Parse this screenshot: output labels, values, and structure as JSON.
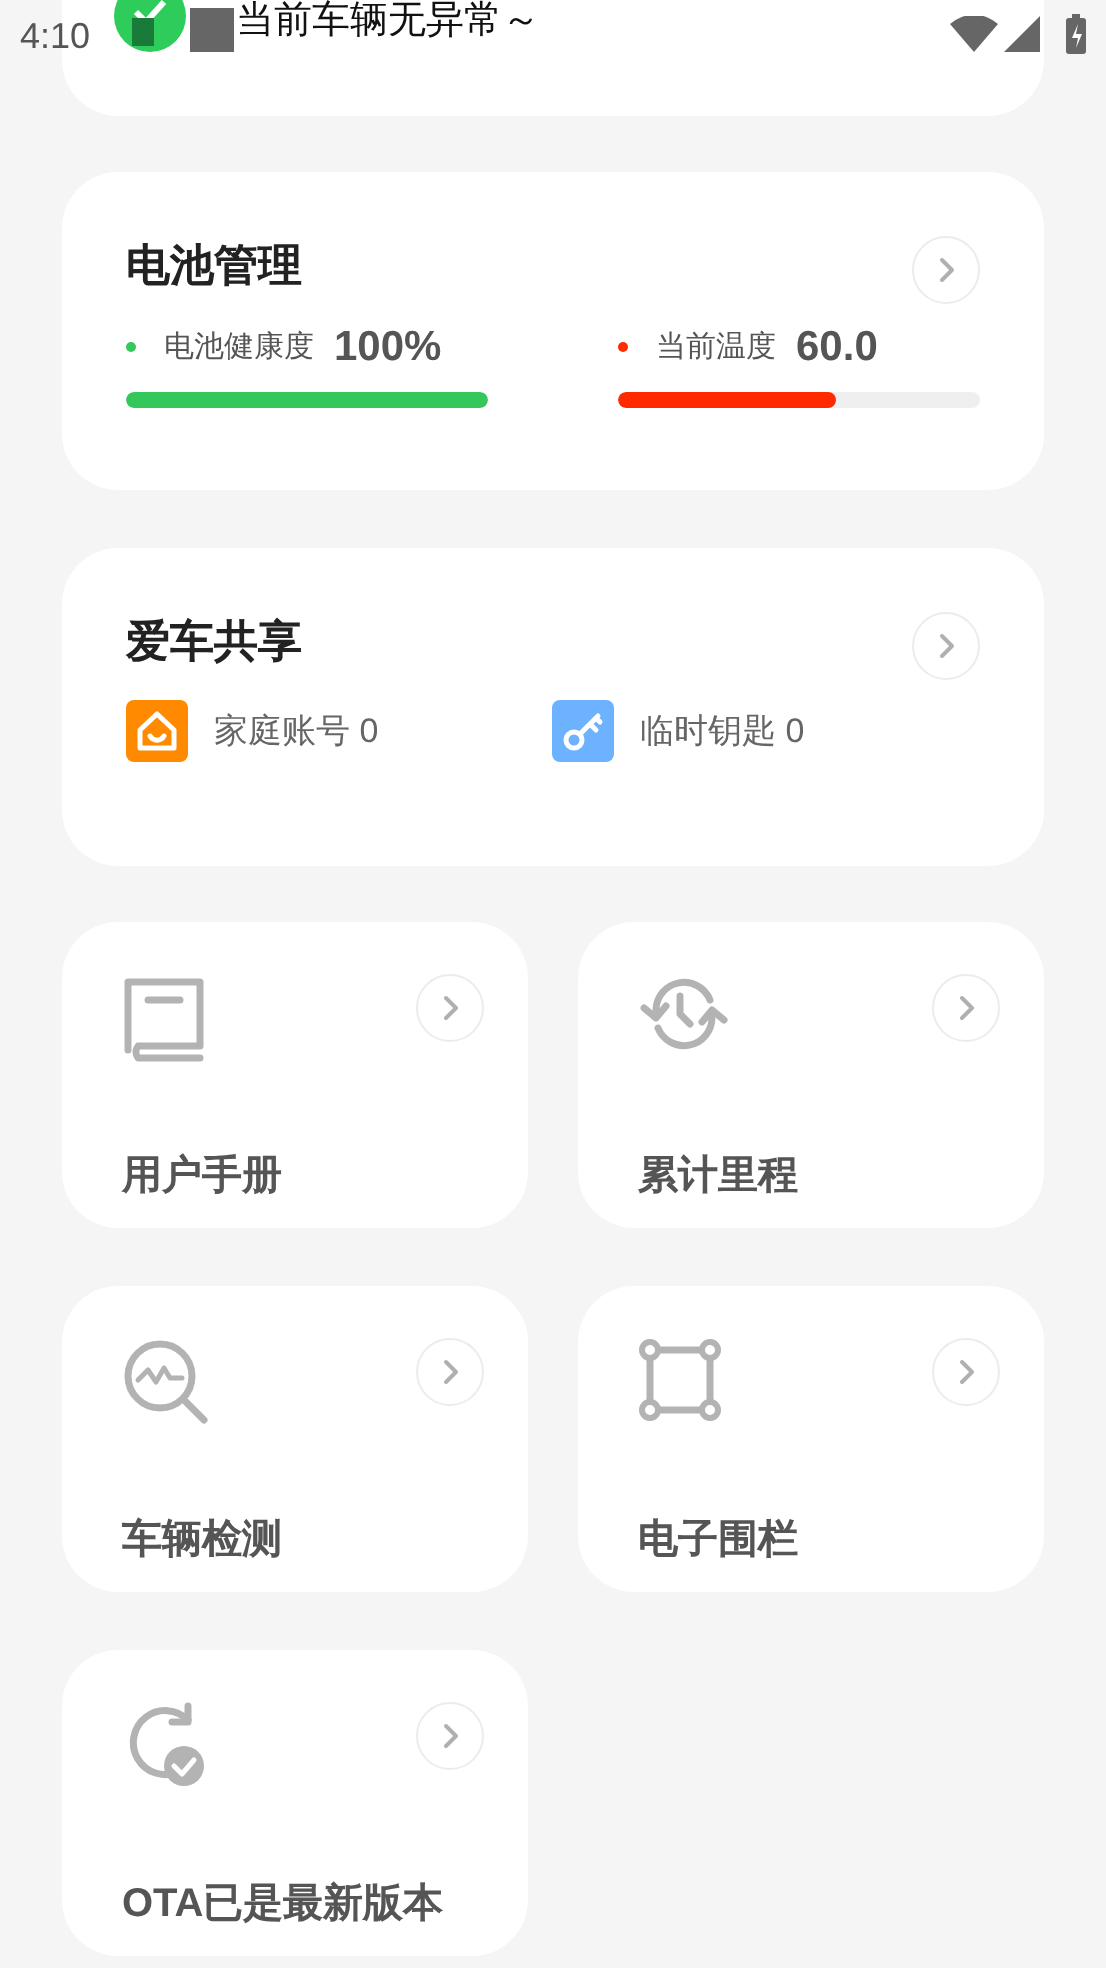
{
  "status_bar": {
    "time": "4:10"
  },
  "notice": {
    "text": "当前车辆无异常～"
  },
  "battery": {
    "title": "电池管理",
    "metrics": [
      {
        "label": "电池健康度",
        "value": "100%",
        "color": "#34c759",
        "level": 1
      },
      {
        "label": "当前温度",
        "value": "60.0",
        "color": "#ff2a00",
        "level": 0.6
      }
    ]
  },
  "sharing": {
    "title": "爱车共享",
    "items": [
      {
        "kind": "family",
        "label": "家庭账号 0"
      },
      {
        "kind": "key",
        "label": "临时钥匙 0"
      }
    ]
  },
  "tiles": [
    {
      "kind": "manual",
      "title": "用户手册"
    },
    {
      "kind": "mileage",
      "title": "累计里程"
    },
    {
      "kind": "detection",
      "title": "车辆检测"
    },
    {
      "kind": "fence",
      "title": "电子围栏"
    },
    {
      "kind": "ota",
      "title": "OTA已是最新版本"
    }
  ]
}
